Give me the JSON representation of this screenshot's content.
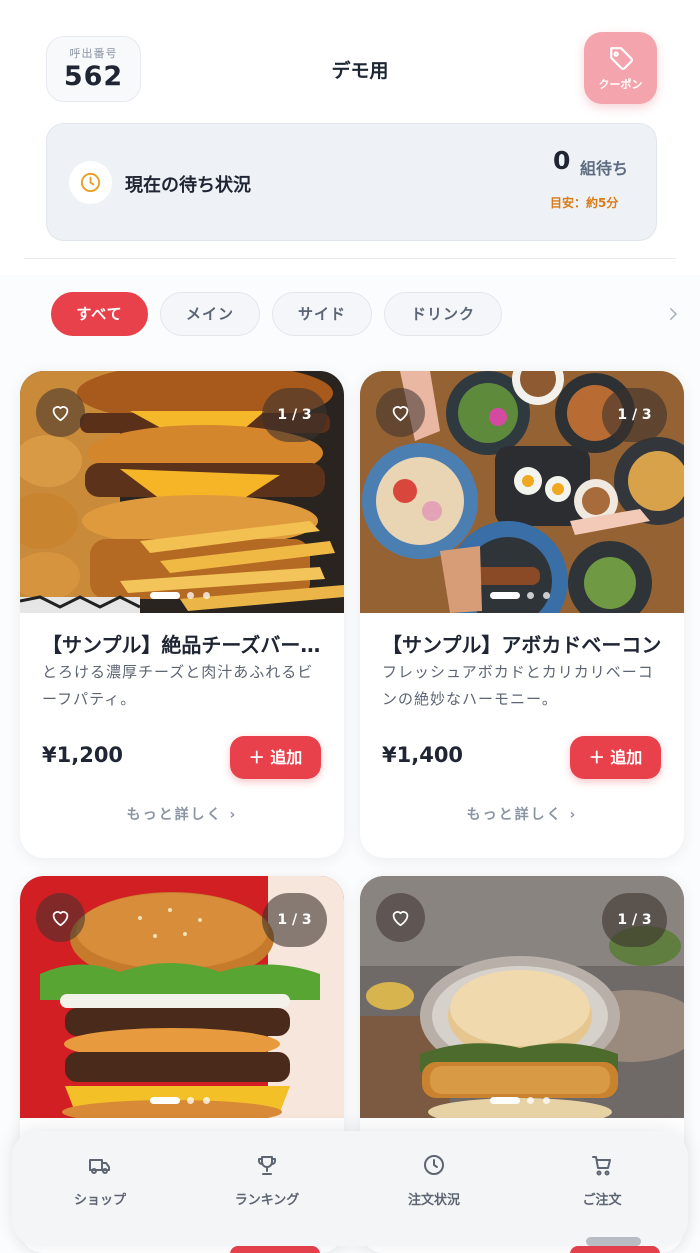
{
  "header": {
    "call_label": "呼出番号",
    "call_number": "562",
    "store_title": "デモ用",
    "coupon_label": "クーポン"
  },
  "wait_status": {
    "title": "現在の待ち状況",
    "count": "0",
    "unit": "組待ち",
    "estimate": "目安：約5分"
  },
  "categories": [
    {
      "label": "すべて",
      "active": true
    },
    {
      "label": "メイン",
      "active": false
    },
    {
      "label": "サイド",
      "active": false
    },
    {
      "label": "ドリンク",
      "active": false
    }
  ],
  "products": [
    {
      "name": "【サンプル】絶品チーズバーガー",
      "description": "とろける濃厚チーズと肉汁あふれるビーフパティ。",
      "price": "¥1,200",
      "image_counter": "1 / 3",
      "add_label": "＋ 追加",
      "more_label": "もっと詳しく ›"
    },
    {
      "name": "【サンプル】アボカドベーコン",
      "description": "フレッシュアボカドとカリカリベーコンの絶妙なハーモニー。",
      "price": "¥1,400",
      "image_counter": "1 / 3",
      "add_label": "＋ 追加",
      "more_label": "もっと詳しく ›"
    },
    {
      "image_counter": "1 / 3"
    },
    {
      "image_counter": "1 / 3"
    }
  ],
  "bottom_nav": [
    {
      "label": "ショップ",
      "icon": "truck-icon"
    },
    {
      "label": "ランキング",
      "icon": "trophy-icon"
    },
    {
      "label": "注文状況",
      "icon": "clock-icon"
    },
    {
      "label": "ご注文",
      "icon": "cart-icon"
    }
  ],
  "colors": {
    "accent": "#e8414b",
    "coupon": "#f3a4ac",
    "estimate": "#d97a14"
  }
}
